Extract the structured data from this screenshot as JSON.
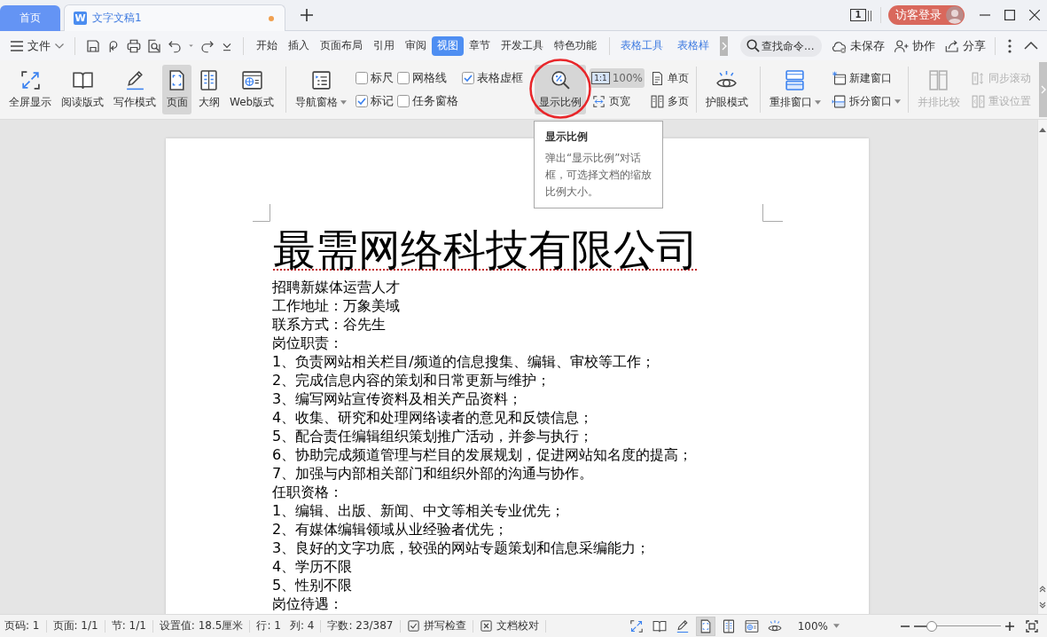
{
  "title_bar": {
    "tabs": [
      {
        "label": "首页",
        "kind": "home",
        "selected": false
      },
      {
        "label": "文字文稿1",
        "kind": "document",
        "icon_letter": "W",
        "selected": true,
        "modified": true
      }
    ],
    "window_count": "1",
    "login_button": "访客登录"
  },
  "menu_bar": {
    "file_menu": "文件",
    "tabs": [
      {
        "label": "开始",
        "selected": false
      },
      {
        "label": "插入",
        "selected": false
      },
      {
        "label": "页面布局",
        "selected": false
      },
      {
        "label": "引用",
        "selected": false
      },
      {
        "label": "审阅",
        "selected": false
      },
      {
        "label": "视图",
        "selected": true
      },
      {
        "label": "章节",
        "selected": false
      },
      {
        "label": "开发工具",
        "selected": false
      },
      {
        "label": "特色功能",
        "selected": false
      }
    ],
    "context_tabs": [
      {
        "label": "表格工具"
      },
      {
        "label": "表格样"
      }
    ],
    "search": {
      "placeholder": "查找命令..."
    },
    "actions": [
      {
        "label": "未保存",
        "kind": "cloud"
      },
      {
        "label": "协作",
        "kind": "collaborate"
      },
      {
        "label": "分享",
        "kind": "share"
      }
    ]
  },
  "ribbon": {
    "view_modes": [
      {
        "label": "全屏显示",
        "kind": "fullscreen",
        "selected": false
      },
      {
        "label": "阅读版式",
        "kind": "read",
        "selected": false
      },
      {
        "label": "写作模式",
        "kind": "write",
        "selected": false
      },
      {
        "label": "页面",
        "kind": "page",
        "selected": true
      },
      {
        "label": "大纲",
        "kind": "outline",
        "selected": false
      },
      {
        "label": "Web版式",
        "kind": "web",
        "selected": false
      }
    ],
    "navigation_pane": {
      "label": "导航窗格",
      "dropdown": true
    },
    "checkboxes": [
      {
        "label": "标尺",
        "checked": false
      },
      {
        "label": "网格线",
        "checked": false
      },
      {
        "label": "表格虚框",
        "checked": true
      },
      {
        "label": "标记",
        "checked": true
      },
      {
        "label": "任务窗格",
        "checked": false
      }
    ],
    "zoom": {
      "label": "显示比例",
      "hovered": true,
      "circled": true
    },
    "zoom_options": [
      {
        "label": "100%",
        "kind": "actual_size",
        "icon_text": "1:1",
        "selected": true
      },
      {
        "label": "页宽",
        "kind": "page_width",
        "selected": false
      },
      {
        "label": "单页",
        "kind": "single_page",
        "selected": false
      },
      {
        "label": "多页",
        "kind": "multi_page",
        "selected": false
      }
    ],
    "eye_mode": {
      "label": "护眼模式"
    },
    "arrange": {
      "label": "重排窗口",
      "dropdown": true
    },
    "window_actions": [
      {
        "label": "新建窗口",
        "kind": "new_window",
        "dropdown": false
      },
      {
        "label": "拆分窗口",
        "kind": "split_window",
        "dropdown": true
      }
    ],
    "compare": {
      "label": "并排比较",
      "disabled": true
    },
    "sync_actions": [
      {
        "label": "同步滚动",
        "kind": "sync_scroll",
        "disabled": true
      },
      {
        "label": "重设位置",
        "kind": "reset_position",
        "disabled": true
      }
    ]
  },
  "tooltip": {
    "title": "显示比例",
    "text": "弹出“显示比例”对话框，可选择文档的缩放比例大小。"
  },
  "document": {
    "heading": "最需网络科技有限公司",
    "heading_spell_error": true,
    "lines": [
      "招聘新媒体运营人才",
      "工作地址：万象美域",
      "联系方式：谷先生",
      "岗位职责：",
      "1、负责网站相关栏目/频道的信息搜集、编辑、审校等工作；",
      "2、完成信息内容的策划和日常更新与维护；",
      "3、编写网站宣传资料及相关产品资料；",
      "4、收集、研究和处理网络读者的意见和反馈信息；",
      "5、配合责任编辑组织策划推广活动，并参与执行；",
      "6、协助完成频道管理与栏目的发展规划，促进网站知名度的提高；",
      "7、加强与内部相关部门和组织外部的沟通与协作。",
      "任职资格：",
      "1、编辑、出版、新闻、中文等相关专业优先；",
      "2、有媒体编辑领域从业经验者优先；",
      "3、良好的文字功底，较强的网站专题策划和信息采编能力；",
      "4、学历不限",
      "5、性别不限",
      "岗位待遇："
    ]
  },
  "status_bar": {
    "field_groups": [
      [
        "页码: 1"
      ],
      [
        "页面: 1/1"
      ],
      [
        "节: 1/1"
      ],
      [
        "设置值: 18.5厘米"
      ],
      [
        "行: 1",
        "列: 4"
      ],
      [
        "字数: 23/387"
      ]
    ],
    "toggles": [
      {
        "label": "拼写检查",
        "kind": "spell_check"
      },
      {
        "label": "文档校对",
        "kind": "proofread"
      }
    ],
    "view_buttons": [
      {
        "kind": "fullscreen",
        "selected": false
      },
      {
        "kind": "read",
        "selected": false
      },
      {
        "kind": "write",
        "selected": false
      },
      {
        "kind": "page",
        "selected": true
      },
      {
        "kind": "outline",
        "selected": false
      },
      {
        "kind": "web",
        "selected": false
      },
      {
        "kind": "eye",
        "selected": false
      }
    ],
    "zoom": "100%",
    "zoom_slider": {
      "level": 0.2
    }
  }
}
